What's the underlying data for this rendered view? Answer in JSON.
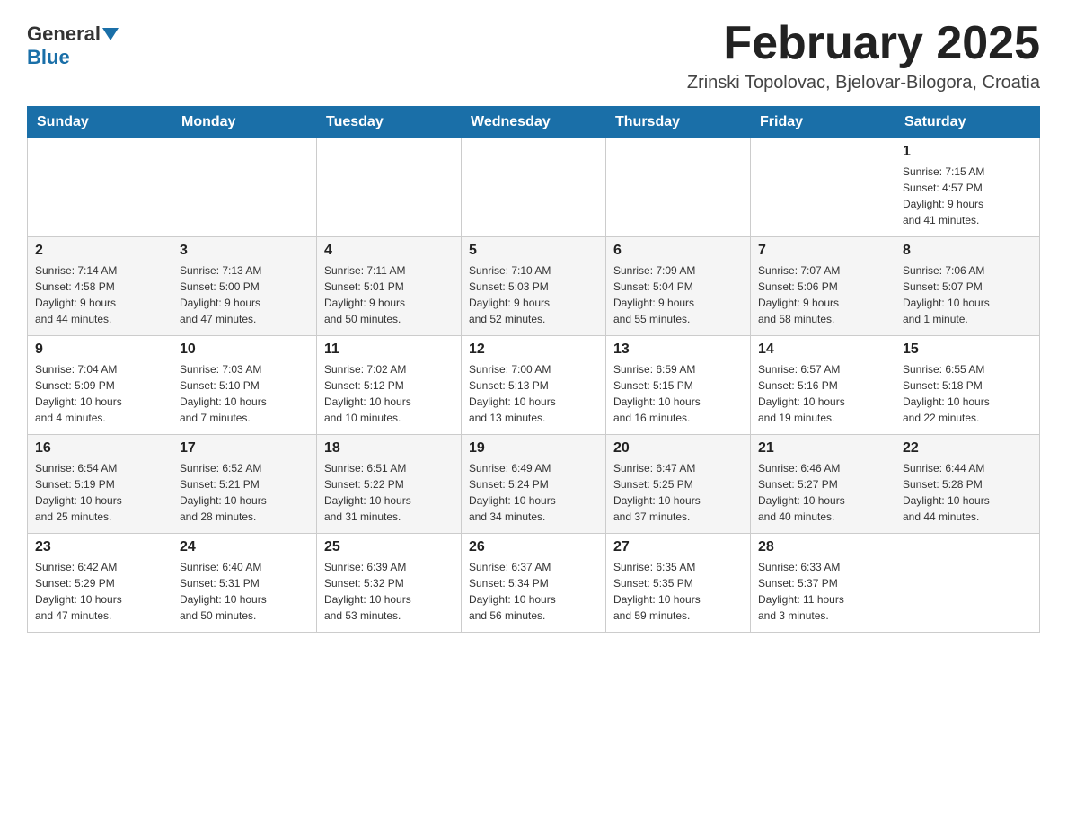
{
  "header": {
    "logo_general": "General",
    "logo_blue": "Blue",
    "title": "February 2025",
    "location": "Zrinski Topolovac, Bjelovar-Bilogora, Croatia"
  },
  "days_of_week": [
    "Sunday",
    "Monday",
    "Tuesday",
    "Wednesday",
    "Thursday",
    "Friday",
    "Saturday"
  ],
  "weeks": [
    {
      "days": [
        {
          "num": "",
          "info": ""
        },
        {
          "num": "",
          "info": ""
        },
        {
          "num": "",
          "info": ""
        },
        {
          "num": "",
          "info": ""
        },
        {
          "num": "",
          "info": ""
        },
        {
          "num": "",
          "info": ""
        },
        {
          "num": "1",
          "info": "Sunrise: 7:15 AM\nSunset: 4:57 PM\nDaylight: 9 hours\nand 41 minutes."
        }
      ]
    },
    {
      "days": [
        {
          "num": "2",
          "info": "Sunrise: 7:14 AM\nSunset: 4:58 PM\nDaylight: 9 hours\nand 44 minutes."
        },
        {
          "num": "3",
          "info": "Sunrise: 7:13 AM\nSunset: 5:00 PM\nDaylight: 9 hours\nand 47 minutes."
        },
        {
          "num": "4",
          "info": "Sunrise: 7:11 AM\nSunset: 5:01 PM\nDaylight: 9 hours\nand 50 minutes."
        },
        {
          "num": "5",
          "info": "Sunrise: 7:10 AM\nSunset: 5:03 PM\nDaylight: 9 hours\nand 52 minutes."
        },
        {
          "num": "6",
          "info": "Sunrise: 7:09 AM\nSunset: 5:04 PM\nDaylight: 9 hours\nand 55 minutes."
        },
        {
          "num": "7",
          "info": "Sunrise: 7:07 AM\nSunset: 5:06 PM\nDaylight: 9 hours\nand 58 minutes."
        },
        {
          "num": "8",
          "info": "Sunrise: 7:06 AM\nSunset: 5:07 PM\nDaylight: 10 hours\nand 1 minute."
        }
      ]
    },
    {
      "days": [
        {
          "num": "9",
          "info": "Sunrise: 7:04 AM\nSunset: 5:09 PM\nDaylight: 10 hours\nand 4 minutes."
        },
        {
          "num": "10",
          "info": "Sunrise: 7:03 AM\nSunset: 5:10 PM\nDaylight: 10 hours\nand 7 minutes."
        },
        {
          "num": "11",
          "info": "Sunrise: 7:02 AM\nSunset: 5:12 PM\nDaylight: 10 hours\nand 10 minutes."
        },
        {
          "num": "12",
          "info": "Sunrise: 7:00 AM\nSunset: 5:13 PM\nDaylight: 10 hours\nand 13 minutes."
        },
        {
          "num": "13",
          "info": "Sunrise: 6:59 AM\nSunset: 5:15 PM\nDaylight: 10 hours\nand 16 minutes."
        },
        {
          "num": "14",
          "info": "Sunrise: 6:57 AM\nSunset: 5:16 PM\nDaylight: 10 hours\nand 19 minutes."
        },
        {
          "num": "15",
          "info": "Sunrise: 6:55 AM\nSunset: 5:18 PM\nDaylight: 10 hours\nand 22 minutes."
        }
      ]
    },
    {
      "days": [
        {
          "num": "16",
          "info": "Sunrise: 6:54 AM\nSunset: 5:19 PM\nDaylight: 10 hours\nand 25 minutes."
        },
        {
          "num": "17",
          "info": "Sunrise: 6:52 AM\nSunset: 5:21 PM\nDaylight: 10 hours\nand 28 minutes."
        },
        {
          "num": "18",
          "info": "Sunrise: 6:51 AM\nSunset: 5:22 PM\nDaylight: 10 hours\nand 31 minutes."
        },
        {
          "num": "19",
          "info": "Sunrise: 6:49 AM\nSunset: 5:24 PM\nDaylight: 10 hours\nand 34 minutes."
        },
        {
          "num": "20",
          "info": "Sunrise: 6:47 AM\nSunset: 5:25 PM\nDaylight: 10 hours\nand 37 minutes."
        },
        {
          "num": "21",
          "info": "Sunrise: 6:46 AM\nSunset: 5:27 PM\nDaylight: 10 hours\nand 40 minutes."
        },
        {
          "num": "22",
          "info": "Sunrise: 6:44 AM\nSunset: 5:28 PM\nDaylight: 10 hours\nand 44 minutes."
        }
      ]
    },
    {
      "days": [
        {
          "num": "23",
          "info": "Sunrise: 6:42 AM\nSunset: 5:29 PM\nDaylight: 10 hours\nand 47 minutes."
        },
        {
          "num": "24",
          "info": "Sunrise: 6:40 AM\nSunset: 5:31 PM\nDaylight: 10 hours\nand 50 minutes."
        },
        {
          "num": "25",
          "info": "Sunrise: 6:39 AM\nSunset: 5:32 PM\nDaylight: 10 hours\nand 53 minutes."
        },
        {
          "num": "26",
          "info": "Sunrise: 6:37 AM\nSunset: 5:34 PM\nDaylight: 10 hours\nand 56 minutes."
        },
        {
          "num": "27",
          "info": "Sunrise: 6:35 AM\nSunset: 5:35 PM\nDaylight: 10 hours\nand 59 minutes."
        },
        {
          "num": "28",
          "info": "Sunrise: 6:33 AM\nSunset: 5:37 PM\nDaylight: 11 hours\nand 3 minutes."
        },
        {
          "num": "",
          "info": ""
        }
      ]
    }
  ]
}
